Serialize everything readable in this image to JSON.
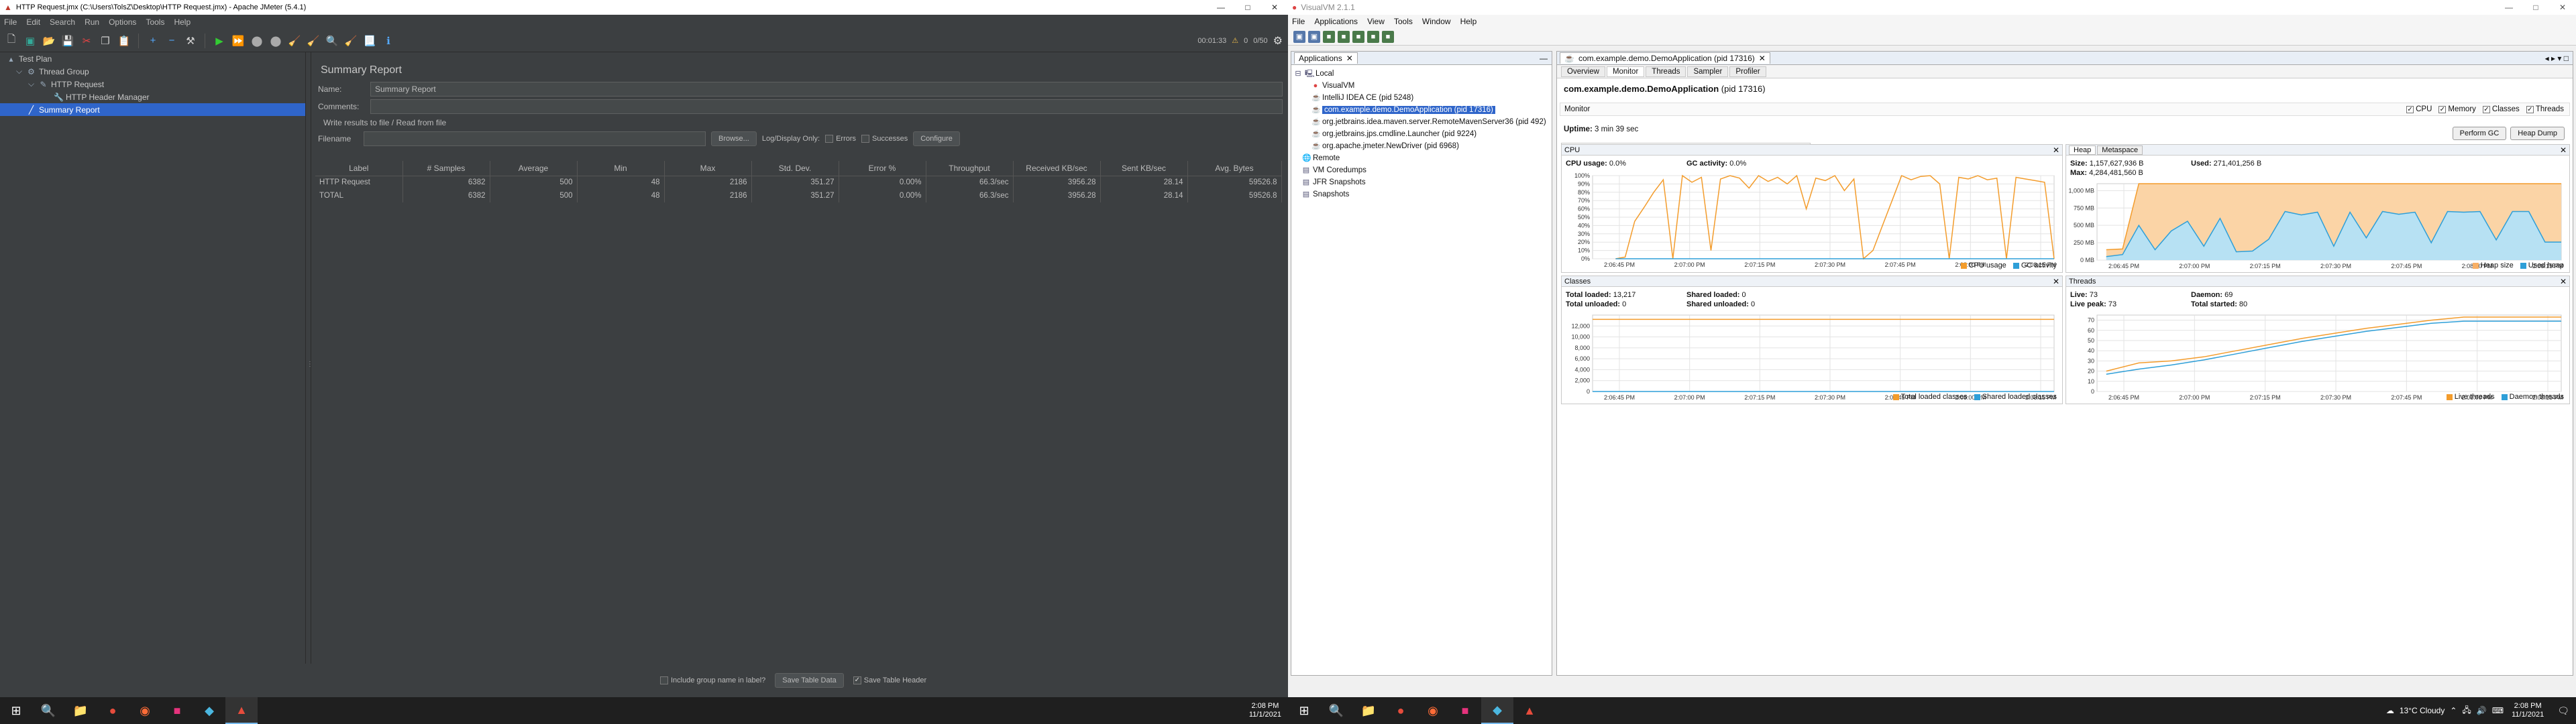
{
  "jmeter": {
    "window_title": "HTTP Request.jmx (C:\\Users\\TolsZ\\Desktop\\HTTP Request.jmx) - Apache JMeter (5.4.1)",
    "menu": [
      "File",
      "Edit",
      "Search",
      "Run",
      "Options",
      "Tools",
      "Help"
    ],
    "timer": "00:01:33",
    "warn_count": "0",
    "threads": "0/50",
    "tree": [
      {
        "label": "Test Plan",
        "level": 0,
        "icon": "test-plan-icon"
      },
      {
        "label": "Thread Group",
        "level": 1,
        "icon": "gear-icon"
      },
      {
        "label": "HTTP Request",
        "level": 2,
        "icon": "pencil-icon"
      },
      {
        "label": "HTTP Header Manager",
        "level": 3,
        "icon": "wrench-icon"
      },
      {
        "label": "Summary Report",
        "level": 2,
        "icon": "chart-icon",
        "selected": true
      }
    ],
    "panel_title": "Summary Report",
    "name_label": "Name:",
    "name_value": "Summary Report",
    "comments_label": "Comments:",
    "write_results": "Write results to file / Read from file",
    "filename_label": "Filename",
    "browse": "Browse...",
    "log_display_only": "Log/Display Only:",
    "errors": "Errors",
    "successes": "Successes",
    "configure": "Configure",
    "columns": [
      "Label",
      "# Samples",
      "Average",
      "Min",
      "Max",
      "Std. Dev.",
      "Error %",
      "Throughput",
      "Received KB/sec",
      "Sent KB/sec",
      "Avg. Bytes"
    ],
    "rows": [
      [
        "HTTP Request",
        "6382",
        "500",
        "48",
        "2186",
        "351.27",
        "0.00%",
        "66.3/sec",
        "3956.28",
        "28.14",
        "59526.8"
      ],
      [
        "TOTAL",
        "6382",
        "500",
        "48",
        "2186",
        "351.27",
        "0.00%",
        "66.3/sec",
        "3956.28",
        "28.14",
        "59526.8"
      ]
    ],
    "include_group": "Include group name in label?",
    "save_table_data": "Save Table Data",
    "save_table_header": "Save Table Header"
  },
  "visualvm": {
    "window_title": "VisualVM 2.1.1",
    "menu": [
      "File",
      "Applications",
      "View",
      "Tools",
      "Window",
      "Help"
    ],
    "apps_tab": "Applications",
    "apps_tree": [
      {
        "label": "Local",
        "level": 0
      },
      {
        "label": "VisualVM",
        "level": 1
      },
      {
        "label": "IntelliJ IDEA CE (pid 5248)",
        "level": 1
      },
      {
        "label": "com.example.demo.DemoApplication (pid 17316)",
        "level": 1,
        "selected": true
      },
      {
        "label": "org.jetbrains.idea.maven.server.RemoteMavenServer36 (pid 492)",
        "level": 1
      },
      {
        "label": "org.jetbrains.jps.cmdline.Launcher (pid 9224)",
        "level": 1
      },
      {
        "label": "org.apache.jmeter.NewDriver (pid 6968)",
        "level": 1
      },
      {
        "label": "Remote",
        "level": 0
      },
      {
        "label": "VM Coredumps",
        "level": 0
      },
      {
        "label": "JFR Snapshots",
        "level": 0
      },
      {
        "label": "Snapshots",
        "level": 0
      }
    ],
    "doc_tab": "com.example.demo.DemoApplication (pid 17316)",
    "subtabs": [
      "Overview",
      "Monitor",
      "Threads",
      "Sampler",
      "Profiler"
    ],
    "app_name": "com.example.demo.DemoApplication",
    "app_pid": "(pid 17316)",
    "monitor_label": "Monitor",
    "checks": [
      "CPU",
      "Memory",
      "Classes",
      "Threads"
    ],
    "uptime_label": "Uptime:",
    "uptime": "3 min 39 sec",
    "perform_gc": "Perform GC",
    "heap_dump": "Heap Dump",
    "cpu": {
      "title": "CPU",
      "usage_label": "CPU usage:",
      "usage": "0.0%",
      "gc_label": "GC activity:",
      "gc": "0.0%",
      "legend": [
        "CPU usage",
        "GC activity"
      ],
      "colors": {
        "cpu": "#f39c2c",
        "gc": "#2e9fd8"
      }
    },
    "heap": {
      "tabs": [
        "Heap",
        "Metaspace"
      ],
      "size_label": "Size:",
      "size": "1,157,627,936 B",
      "used_label": "Used:",
      "used": "271,401,256 B",
      "max_label": "Max:",
      "max": "4,284,481,560 B",
      "legend": [
        "Heap size",
        "Used heap"
      ]
    },
    "classes": {
      "title": "Classes",
      "total_loaded_label": "Total loaded:",
      "total_loaded": "13,217",
      "total_unloaded_label": "Total unloaded:",
      "total_unloaded": "0",
      "shared_loaded_label": "Shared loaded:",
      "shared_loaded": "0",
      "shared_unloaded_label": "Shared unloaded:",
      "shared_unloaded": "0",
      "legend": [
        "Total loaded classes",
        "Shared loaded classes"
      ]
    },
    "threads": {
      "title": "Threads",
      "live_label": "Live:",
      "live": "73",
      "live_peak_label": "Live peak:",
      "live_peak": "73",
      "daemon_label": "Daemon:",
      "daemon": "69",
      "total_started_label": "Total started:",
      "total_started": "80",
      "legend": [
        "Live threads",
        "Daemon threads"
      ]
    },
    "time_ticks": [
      "2:06:45 PM",
      "2:07:00 PM",
      "2:07:15 PM",
      "2:07:30 PM",
      "2:07:45 PM",
      "2:08:00 PM",
      "2:08:15 PM"
    ]
  },
  "chart_data": [
    {
      "type": "line",
      "title": "CPU",
      "ylim": [
        0,
        100
      ],
      "yticks": [
        "0%",
        "10%",
        "20%",
        "30%",
        "40%",
        "50%",
        "60%",
        "70%",
        "80%",
        "90%",
        "100%"
      ],
      "x": [
        "2:06:45 PM",
        "2:07:00 PM",
        "2:07:15 PM",
        "2:07:30 PM",
        "2:07:45 PM",
        "2:08:00 PM",
        "2:08:15 PM"
      ],
      "series": [
        {
          "name": "CPU usage",
          "values": [
            0,
            2,
            45,
            62,
            80,
            95,
            0,
            100,
            92,
            98,
            10,
            96,
            100,
            97,
            85,
            100,
            93,
            98,
            90,
            100,
            60,
            97,
            94,
            100,
            82,
            96,
            0,
            10,
            40,
            70,
            100,
            95,
            99,
            100,
            90,
            0,
            98,
            96,
            100,
            95,
            97,
            0,
            98,
            96,
            94,
            92,
            0
          ]
        },
        {
          "name": "GC activity",
          "values": [
            0,
            0,
            0,
            0,
            0,
            0,
            0,
            0,
            0,
            0,
            0,
            0,
            0,
            0,
            0,
            0,
            0,
            0,
            0,
            0,
            0,
            0,
            0,
            0,
            0,
            0,
            0,
            0,
            0,
            0,
            0,
            0,
            0,
            0,
            0,
            0,
            0,
            0,
            0,
            0,
            0,
            0,
            0,
            0,
            0,
            0,
            0
          ]
        }
      ]
    },
    {
      "type": "area",
      "title": "Heap",
      "ylim": [
        0,
        1100
      ],
      "yticks": [
        "0 MB",
        "250 MB",
        "500 MB",
        "750 MB",
        "1,000 MB"
      ],
      "series": [
        {
          "name": "Heap size",
          "values": [
            150,
            160,
            1100,
            1100,
            1100,
            1100,
            1100,
            1100,
            1100,
            1100,
            1100,
            1100,
            1100,
            1100,
            1100,
            1100,
            1100,
            1100,
            1100,
            1100,
            1100,
            1100,
            1100,
            1100,
            1100,
            1100,
            1100,
            1100,
            1100
          ]
        },
        {
          "name": "Used heap",
          "values": [
            50,
            80,
            500,
            150,
            420,
            560,
            200,
            600,
            120,
            130,
            300,
            700,
            650,
            690,
            200,
            690,
            320,
            700,
            660,
            690,
            250,
            700,
            690,
            700,
            290,
            700,
            700,
            260,
            260
          ]
        }
      ]
    },
    {
      "type": "line",
      "title": "Classes",
      "ylim": [
        0,
        14000
      ],
      "yticks": [
        "0",
        "2,000",
        "4,000",
        "6,000",
        "8,000",
        "10,000",
        "12,000"
      ],
      "series": [
        {
          "name": "Total loaded classes",
          "values": [
            13217,
            13217,
            13217,
            13217,
            13217,
            13217,
            13217,
            13217
          ]
        },
        {
          "name": "Shared loaded classes",
          "values": [
            0,
            0,
            0,
            0,
            0,
            0,
            0,
            0
          ]
        }
      ]
    },
    {
      "type": "line",
      "title": "Threads",
      "ylim": [
        0,
        75
      ],
      "yticks": [
        "0",
        "10",
        "20",
        "30",
        "40",
        "50",
        "60",
        "70"
      ],
      "series": [
        {
          "name": "Live threads",
          "values": [
            20,
            28,
            30,
            34,
            40,
            46,
            52,
            57,
            62,
            66,
            70,
            73,
            73,
            73,
            73
          ]
        },
        {
          "name": "Daemon threads",
          "values": [
            17,
            22,
            26,
            31,
            37,
            43,
            49,
            54,
            59,
            63,
            67,
            69,
            69,
            69,
            69
          ]
        }
      ]
    }
  ],
  "taskbar": {
    "left_time": "2:08 PM",
    "left_date": "11/1/2021",
    "weather": "13°C  Cloudy",
    "right_time": "2:08 PM",
    "right_date": "11/1/2021"
  }
}
